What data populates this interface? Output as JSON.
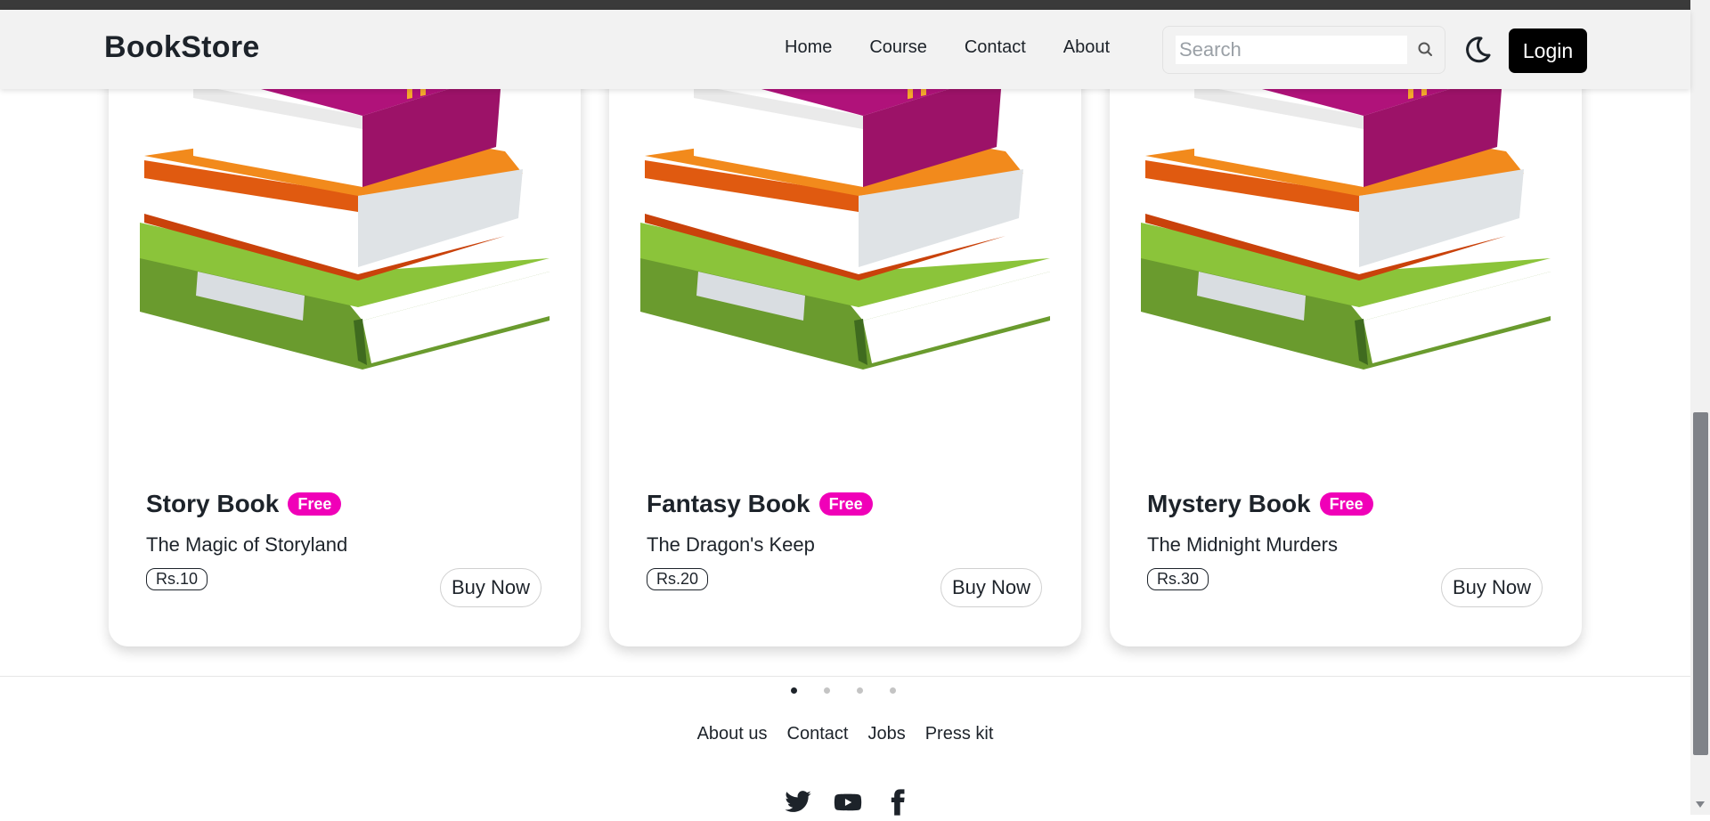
{
  "header": {
    "brand": "BookStore",
    "nav": [
      {
        "label": "Home"
      },
      {
        "label": "Course"
      },
      {
        "label": "Contact"
      },
      {
        "label": "About"
      }
    ],
    "search_placeholder": "Search",
    "login_label": "Login",
    "icons": {
      "search": "search-icon",
      "theme": "moon-icon"
    }
  },
  "cards": [
    {
      "title": "Story Book",
      "badge": "Free",
      "subtitle": "The Magic of Storyland",
      "price": "Rs.10",
      "button": "Buy Now"
    },
    {
      "title": "Fantasy Book",
      "badge": "Free",
      "subtitle": "The Dragon's Keep",
      "price": "Rs.20",
      "button": "Buy Now"
    },
    {
      "title": "Mystery Book",
      "badge": "Free",
      "subtitle": "The Midnight Murders",
      "price": "Rs.30",
      "button": "Buy Now"
    }
  ],
  "carousel": {
    "pages": 4,
    "active": 1
  },
  "footer": {
    "links": [
      {
        "label": "About us"
      },
      {
        "label": "Contact"
      },
      {
        "label": "Jobs"
      },
      {
        "label": "Press kit"
      }
    ],
    "socials": [
      "twitter-icon",
      "youtube-icon",
      "facebook-icon"
    ]
  },
  "colors": {
    "badge": "#f000b8",
    "login_bg": "#000000",
    "navbar_bg": "#f2f2f2"
  }
}
